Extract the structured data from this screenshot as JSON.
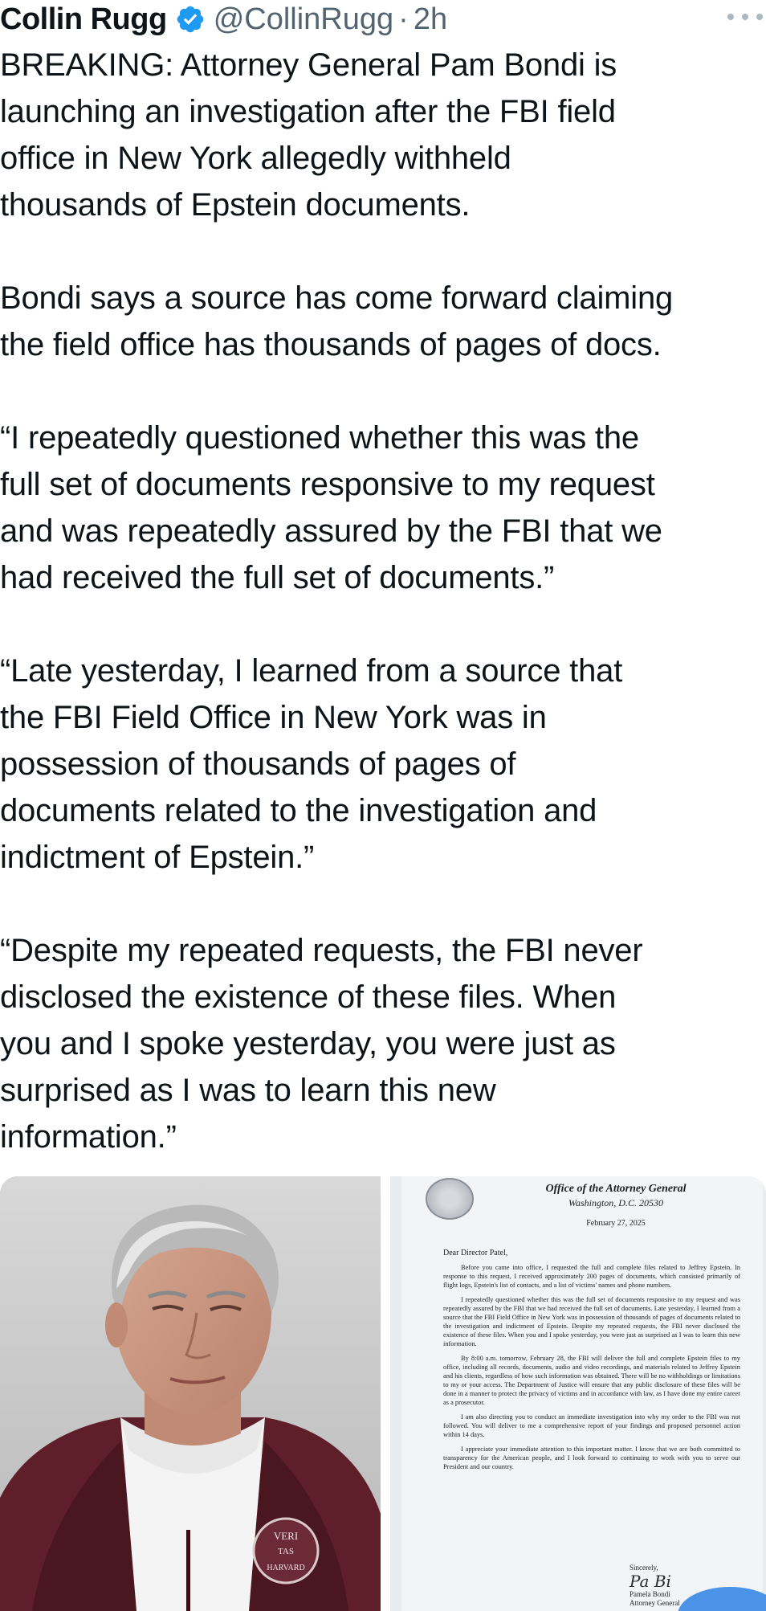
{
  "tweet": {
    "author_name": "Collin Rugg",
    "handle": "@CollinRugg",
    "separator": "·",
    "time_ago": "2h",
    "paragraphs": [
      "BREAKING: Attorney General Pam Bondi is\nlaunching an investigation after the FBI field\noffice in New York allegedly withheld\nthousands of Epstein documents.",
      "Bondi says a source has come forward claiming\nthe field office has thousands of pages of docs.",
      "“I repeatedly questioned whether this was the\nfull set of documents responsive to my request\nand was repeatedly assured by the FBI that we\nhad received the full set of documents.”",
      "“Late yesterday, I learned from a source that\nthe FBI Field Office in New York was in\npossession of thousands of pages of\ndocuments related to the investigation and\nindictment of Epstein.”",
      "“Despite my repeated requests, the FBI never\ndisclosed the existence of these files. When\nyou and I spoke yesterday, you were just as\nsurprised as I was to learn this new\ninformation.”"
    ]
  },
  "media": {
    "photo_emblem_lines": [
      "VERI",
      "TAS",
      "HARVARD"
    ],
    "letter": {
      "office": "Office of the Attorney General",
      "address": "Washington, D.C. 20530",
      "date": "February 27, 2025",
      "salutation": "Dear Director Patel,",
      "paragraphs": [
        "Before you came into office, I requested the full and complete files related to Jeffrey Epstein. In response to this request, I received approximately 200 pages of documents, which consisted primarily of flight logs, Epstein's list of contacts, and a list of victims' names and phone numbers.",
        "I repeatedly questioned whether this was the full set of documents responsive to my request and was repeatedly assured by the FBI that we had received the full set of documents. Late yesterday, I learned from a source that the FBI Field Office in New York was in possession of thousands of pages of documents related to the investigation and indictment of Epstein. Despite my repeated requests, the FBI never disclosed the existence of these files. When you and I spoke yesterday, you were just as surprised as I was to learn this new information.",
        "By 8:00 a.m. tomorrow, February 28, the FBI will deliver the full and complete Epstein files to my office, including all records, documents, audio and video recordings, and materials related to Jeffrey Epstein and his clients, regardless of how such information was obtained. There will be no withholdings or limitations to my or your access. The Department of Justice will ensure that any public disclosure of these files will be done in a manner to protect the privacy of victims and in accordance with law, as I have done my entire career as a prosecutor.",
        "I am also directing you to conduct an immediate investigation into why my order to the FBI was not followed. You will deliver to me a comprehensive report of your findings and proposed personnel action within 14 days.",
        "I appreciate your immediate attention to this important matter. I know that we are both committed to transparency for the American people, and I look forward to continuing to work with you to serve our President and our country."
      ],
      "closing": "Sincerely,",
      "signer_name": "Pamela Bondi",
      "signer_title": "Attorney General"
    }
  },
  "colors": {
    "text": "#0f1419",
    "secondary": "#536471",
    "verified": "#1d9bf0"
  },
  "icons": {
    "verified": "verified-badge-icon",
    "more": "more-options-icon"
  }
}
